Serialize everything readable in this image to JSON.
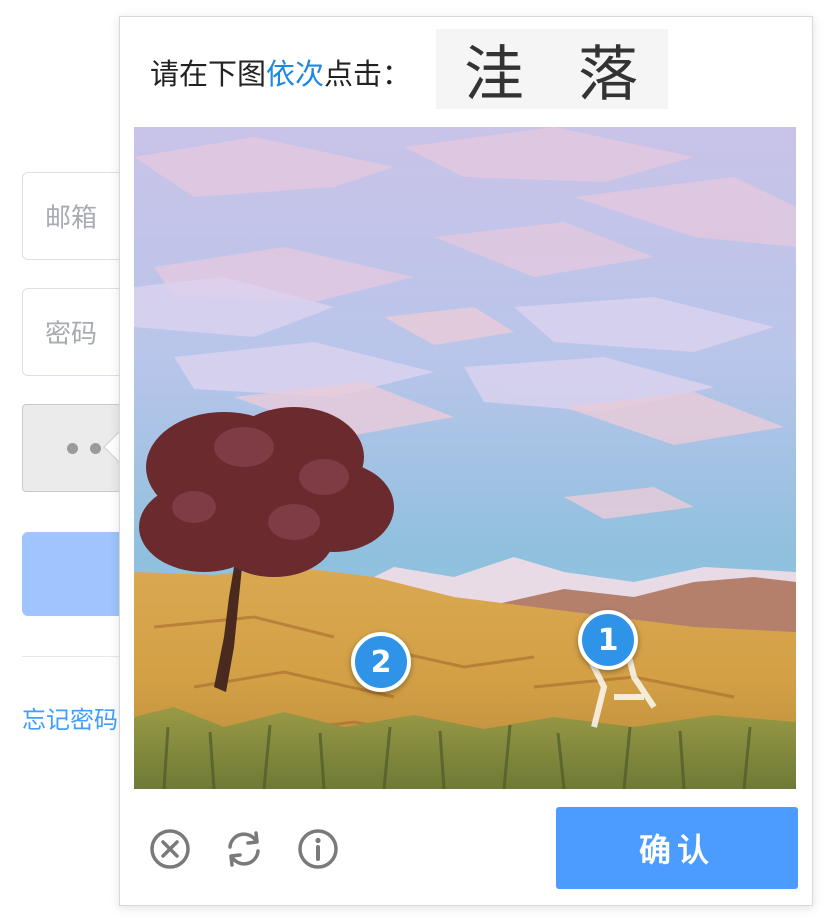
{
  "login_form": {
    "email_placeholder": "邮箱",
    "password_placeholder": "密码",
    "forgot_password_text": "忘记密码"
  },
  "captcha": {
    "prompt_prefix": "请在下图",
    "prompt_highlight": "依次",
    "prompt_suffix": "点击：",
    "target_char_1": "洼",
    "target_char_2": "落",
    "markers": [
      {
        "label": "1"
      },
      {
        "label": "2"
      }
    ],
    "confirm_label": "确认",
    "icons": {
      "close": "close-circle-icon",
      "refresh": "refresh-icon",
      "info": "info-icon"
    },
    "colors": {
      "highlight": "#1e88e5",
      "marker": "#2f93e8",
      "confirm": "#4c9bff"
    }
  }
}
